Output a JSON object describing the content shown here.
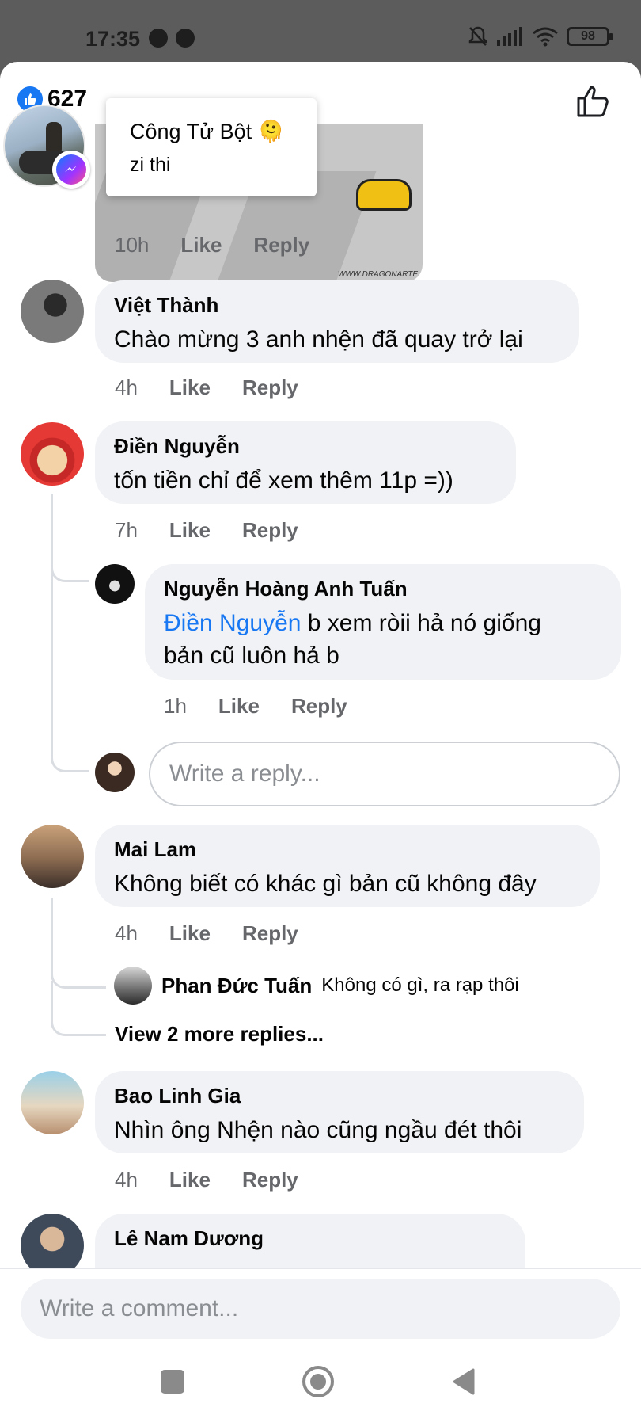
{
  "status_bar": {
    "time": "17:35",
    "battery": "98",
    "icons": [
      "messenger-icon",
      "facebook-icon",
      "mute-icon",
      "signal-icon",
      "wifi-icon",
      "battery-icon"
    ]
  },
  "header": {
    "like_count": "627",
    "icons": [
      "like-reaction-icon",
      "thumbs-up-icon"
    ]
  },
  "popup": {
    "name": "Công Tử Bột 🫠",
    "message": "zi thi"
  },
  "sticker": {
    "watermark": "WWW.DRAGONARTE"
  },
  "first_comment_meta": {
    "time": "10h",
    "like": "Like",
    "reply": "Reply"
  },
  "comments": [
    {
      "name": "Việt Thành",
      "text": "Chào mừng 3 anh nhện đã quay trở lại",
      "time": "4h",
      "like": "Like",
      "reply": "Reply"
    },
    {
      "name": "Điền Nguyễn",
      "text": "tốn tiền chỉ để xem thêm 11p =))",
      "time": "7h",
      "like": "Like",
      "reply": "Reply"
    },
    {
      "name": "Mai Lam",
      "text": "Không biết có khác gì bản cũ không đây",
      "time": "4h",
      "like": "Like",
      "reply": "Reply"
    },
    {
      "name": "Bao Linh Gia",
      "text": "Nhìn ông Nhện nào cũng ngầu đét thôi",
      "time": "4h",
      "like": "Like",
      "reply": "Reply"
    },
    {
      "name": "Lê Nam Dương",
      "text": ""
    }
  ],
  "nested_reply": {
    "name": "Nguyễn Hoàng Anh Tuấn",
    "mention": "Điền Nguyễn",
    "text_line1": " b xem ròii hả nó giống",
    "text_line2": "bản cũ luôn hả b",
    "time": "1h",
    "like": "Like",
    "reply": "Reply"
  },
  "reply_box": {
    "placeholder": "Write a reply..."
  },
  "compact_reply": {
    "name": "Phan Đức Tuấn",
    "text": "Không có gì, ra rạp thôi"
  },
  "view_more": "View 2 more replies...",
  "composer": {
    "placeholder": "Write a comment..."
  },
  "nav_bar": {
    "icons": [
      "recents-square-icon",
      "home-circle-icon",
      "back-triangle-icon"
    ]
  }
}
